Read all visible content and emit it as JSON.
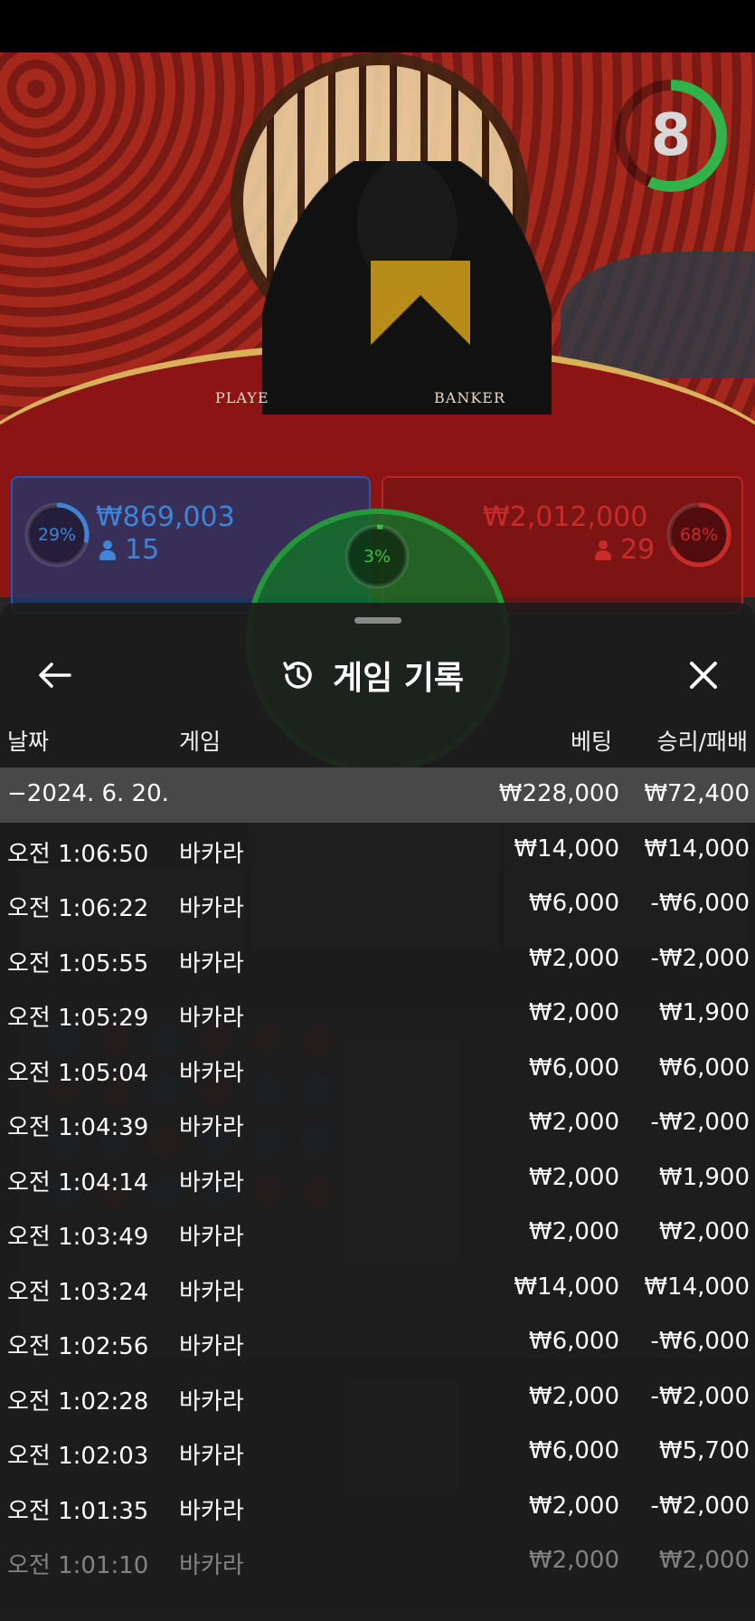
{
  "video": {
    "timer_value": "8",
    "timer_color": "#2fb34a",
    "table_labels": {
      "player": "PLAYE",
      "banker": "BANKER"
    }
  },
  "bets": {
    "player": {
      "percent": "29%",
      "percent_value": 29,
      "amount": "₩869,003",
      "players": "15",
      "color": "#3f84d6"
    },
    "tie": {
      "percent": "3%",
      "percent_value": 3,
      "color": "#3bbf3b"
    },
    "banker": {
      "percent": "68%",
      "percent_value": 68,
      "amount": "₩2,012,000",
      "players": "29",
      "color": "#c92a2a"
    }
  },
  "history": {
    "title": "게임 기록",
    "icons": {
      "back": "arrow-left-icon",
      "history": "history-clock-icon",
      "close": "close-icon"
    },
    "columns": {
      "date": "날짜",
      "game": "게임",
      "bet": "베팅",
      "result": "승리/패배"
    },
    "date_group": {
      "label": "−2024. 6. 20.",
      "bet": "₩228,000",
      "result": "₩72,400"
    },
    "rows": [
      {
        "time": "오전 1:06:50",
        "game": "바카라",
        "bet": "₩14,000",
        "result": "₩14,000"
      },
      {
        "time": "오전 1:06:22",
        "game": "바카라",
        "bet": "₩6,000",
        "result": "-₩6,000"
      },
      {
        "time": "오전 1:05:55",
        "game": "바카라",
        "bet": "₩2,000",
        "result": "-₩2,000"
      },
      {
        "time": "오전 1:05:29",
        "game": "바카라",
        "bet": "₩2,000",
        "result": "₩1,900"
      },
      {
        "time": "오전 1:05:04",
        "game": "바카라",
        "bet": "₩6,000",
        "result": "₩6,000"
      },
      {
        "time": "오전 1:04:39",
        "game": "바카라",
        "bet": "₩2,000",
        "result": "-₩2,000"
      },
      {
        "time": "오전 1:04:14",
        "game": "바카라",
        "bet": "₩2,000",
        "result": "₩1,900"
      },
      {
        "time": "오전 1:03:49",
        "game": "바카라",
        "bet": "₩2,000",
        "result": "₩2,000"
      },
      {
        "time": "오전 1:03:24",
        "game": "바카라",
        "bet": "₩14,000",
        "result": "₩14,000"
      },
      {
        "time": "오전 1:02:56",
        "game": "바카라",
        "bet": "₩6,000",
        "result": "-₩6,000"
      },
      {
        "time": "오전 1:02:28",
        "game": "바카라",
        "bet": "₩2,000",
        "result": "-₩2,000"
      },
      {
        "time": "오전 1:02:03",
        "game": "바카라",
        "bet": "₩6,000",
        "result": "₩5,700"
      },
      {
        "time": "오전 1:01:35",
        "game": "바카라",
        "bet": "₩2,000",
        "result": "-₩2,000"
      },
      {
        "time": "오전 1:01:10",
        "game": "바카라",
        "bet": "₩2,000",
        "result": "₩2,000"
      }
    ]
  }
}
